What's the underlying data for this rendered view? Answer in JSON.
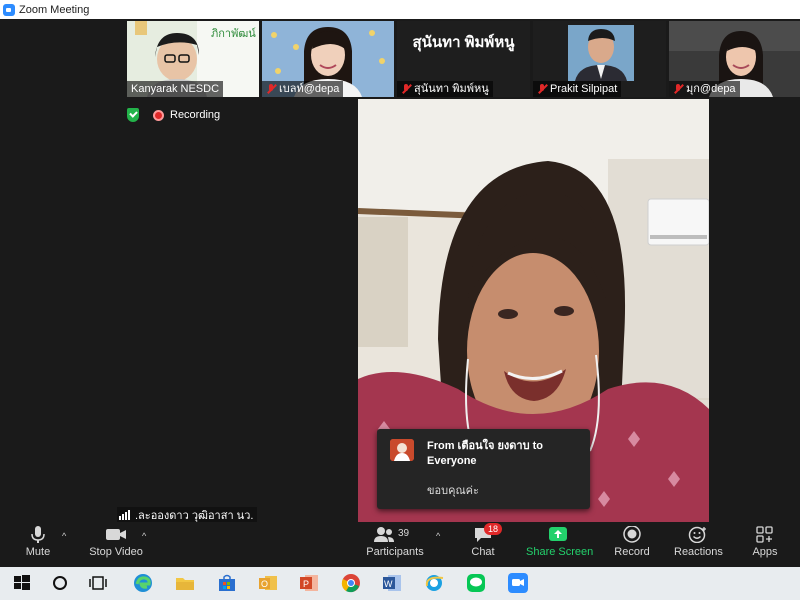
{
  "window": {
    "title": "Zoom Meeting"
  },
  "gallery": {
    "tiles": [
      {
        "name": "Kanyarak NESDC",
        "muted": false
      },
      {
        "name": "เบลท์@depa",
        "muted": true
      },
      {
        "name": "สุนันทา พิมพ์หนู",
        "display_name": "สุนันทา พิมพ์หนู",
        "muted": true
      },
      {
        "name": "Prakit Silpipat",
        "muted": true
      },
      {
        "name": "มุก@depa",
        "muted": true
      }
    ]
  },
  "status": {
    "recording_label": "Recording"
  },
  "chat_toast": {
    "from": "From เตือนใจ ยงดาบ to Everyone",
    "message": "ขอบคุณค่ะ"
  },
  "network_label": ".ละอองดาว วุฒิอาสา นว.",
  "toolbar": {
    "mute": "Mute",
    "stop_video": "Stop Video",
    "participants": "Participants",
    "participants_count": "39",
    "chat": "Chat",
    "chat_badge": "18",
    "share_screen": "Share Screen",
    "record": "Record",
    "reactions": "Reactions",
    "apps": "Apps"
  },
  "taskbar": {
    "icons": [
      "windows-start-icon",
      "search-icon",
      "task-view-icon",
      "edge-icon",
      "file-explorer-icon",
      "store-icon",
      "outlook-icon",
      "powerpoint-icon",
      "chrome-icon",
      "word-icon",
      "internet-explorer-icon",
      "line-icon",
      "zoom-icon"
    ]
  },
  "colors": {
    "accent_blue": "#2d8cff",
    "recording_red": "#e02828",
    "share_green": "#23d16c"
  }
}
